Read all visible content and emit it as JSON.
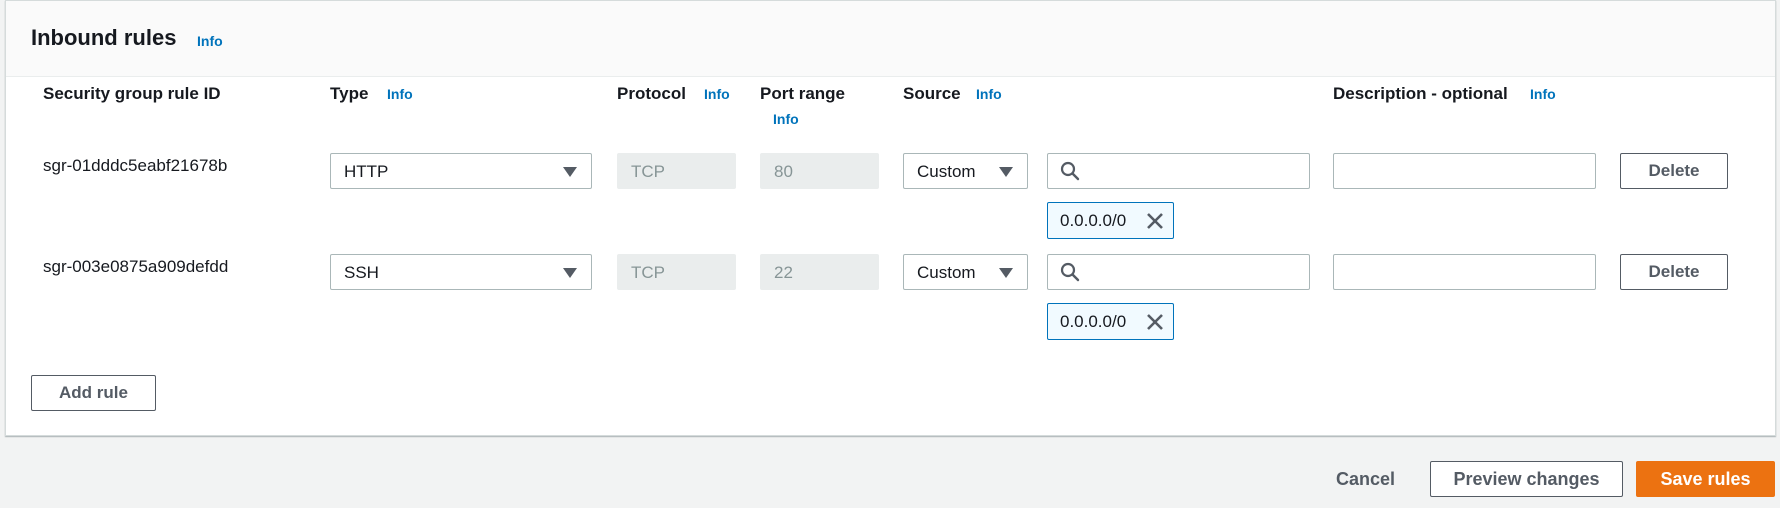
{
  "panel": {
    "title": "Inbound rules",
    "info_label": "Info"
  },
  "columns": {
    "rule_id": "Security group rule ID",
    "type": "Type",
    "protocol": "Protocol",
    "port_range": "Port range",
    "source": "Source",
    "description": "Description - optional",
    "info_label": "Info"
  },
  "rules": [
    {
      "id": "sgr-01dddc5eabf21678b",
      "type": "HTTP",
      "protocol": "TCP",
      "port": "80",
      "source_type": "Custom",
      "search_value": "",
      "cidr": "0.0.0.0/0",
      "description": "",
      "delete_label": "Delete"
    },
    {
      "id": "sgr-003e0875a909defdd",
      "type": "SSH",
      "protocol": "TCP",
      "port": "22",
      "source_type": "Custom",
      "search_value": "",
      "cidr": "0.0.0.0/0",
      "description": "",
      "delete_label": "Delete"
    }
  ],
  "add_rule_label": "Add rule",
  "footer": {
    "cancel": "Cancel",
    "preview": "Preview changes",
    "save": "Save rules"
  },
  "icons": {
    "dropdown": "caret-down-icon",
    "search": "search-icon",
    "remove": "close-icon"
  },
  "colors": {
    "link": "#0073bb",
    "primary": "#ec7211",
    "token_border": "#0073bb",
    "token_bg": "#f1faff"
  }
}
